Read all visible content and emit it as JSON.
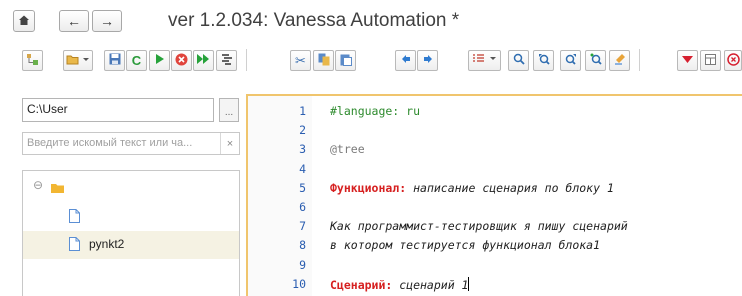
{
  "title": "ver 1.2.034: Vanessa Automation *",
  "nav": {
    "home_glyph": "⌂",
    "back_glyph": "←",
    "forward_glyph": "→"
  },
  "toolbar": {
    "icons": [
      "tree-icon",
      "folder-dropdown-icon",
      "save-icon",
      "refresh-icon",
      "run-icon",
      "stop-icon",
      "run-all-icon",
      "step-icon",
      "cut-icon",
      "copy-icon",
      "paste-icon",
      "prev-icon",
      "next-icon",
      "list-dropdown-icon",
      "search-icon",
      "search-prev-icon",
      "search-next-icon",
      "search-replace-icon",
      "clear-icon",
      "bookmark-icon",
      "table-icon",
      "close-icon"
    ]
  },
  "left_panel": {
    "path_value": "C:\\User",
    "path_button": "...",
    "search_placeholder": "Введите искомый текст или ча...",
    "search_clear": "×",
    "tree": [
      {
        "type": "folder",
        "label": "",
        "expand": "⊖"
      },
      {
        "type": "file",
        "label": ""
      },
      {
        "type": "file",
        "label": "pynkt2",
        "selected": true
      }
    ]
  },
  "editor": {
    "lines": [
      {
        "num": "1",
        "parts": [
          {
            "cls": "c-lang",
            "text": "#language: ru"
          }
        ]
      },
      {
        "num": "2",
        "parts": []
      },
      {
        "num": "3",
        "parts": [
          {
            "cls": "c-tag",
            "text": "@tree"
          }
        ]
      },
      {
        "num": "4",
        "parts": []
      },
      {
        "num": "5",
        "parts": [
          {
            "cls": "c-kw",
            "text": "Функционал:"
          },
          {
            "cls": "c-text",
            "text": " написание сценария по блоку 1"
          }
        ]
      },
      {
        "num": "6",
        "parts": []
      },
      {
        "num": "7",
        "parts": [
          {
            "cls": "c-text",
            "text": "Как программист-тестировщик я пишу сценарий"
          }
        ]
      },
      {
        "num": "8",
        "parts": [
          {
            "cls": "c-text",
            "text": "в котором тестируется функционал блока1"
          }
        ]
      },
      {
        "num": "9",
        "parts": []
      },
      {
        "num": "10",
        "parts": [
          {
            "cls": "c-kw",
            "text": "Сценарий:"
          },
          {
            "cls": "c-text",
            "text": " сценарий 1"
          }
        ],
        "cursor": true
      }
    ]
  },
  "colors": {
    "accent": "#f0c56d",
    "keyword": "#d62020",
    "language": "#2e8b2e",
    "line_number": "#2a5db0"
  }
}
